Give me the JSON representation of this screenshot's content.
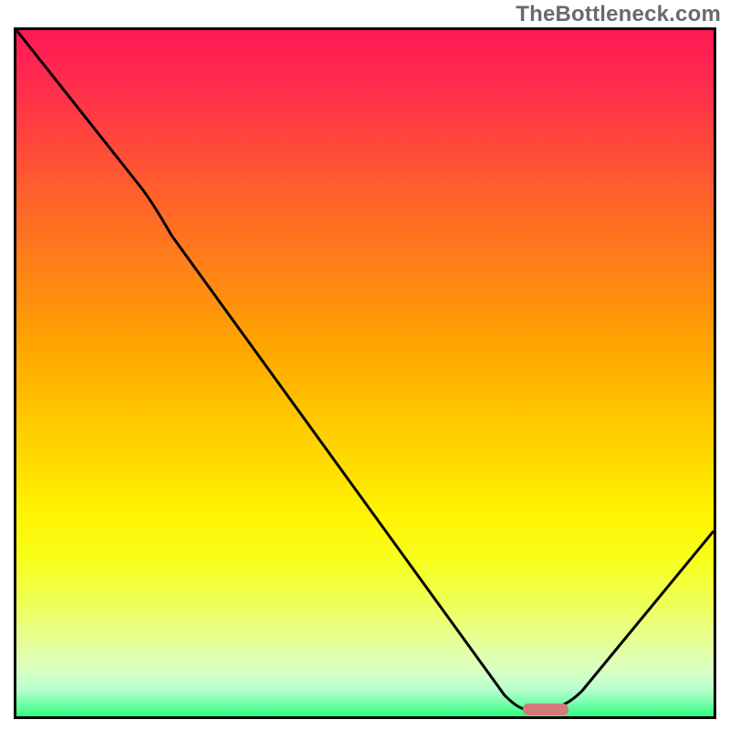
{
  "watermark": "TheBottleneck.com",
  "chart_data": {
    "type": "line",
    "title": "",
    "xlabel": "",
    "ylabel": "",
    "xlim": [
      0,
      100
    ],
    "ylim": [
      0,
      100
    ],
    "series": [
      {
        "name": "bottleneck-curve",
        "x": [
          0,
          18,
          70,
          73,
          76,
          80,
          100
        ],
        "values": [
          100,
          77,
          3,
          1,
          1,
          3,
          27
        ]
      }
    ],
    "marker": {
      "name": "optimal-red-bar",
      "x_start": 73,
      "x_end": 79,
      "y": 1,
      "color": "#d47a7a"
    },
    "gradient_stops": [
      {
        "pos": 0.0,
        "color": "#ff1a55"
      },
      {
        "pos": 0.5,
        "color": "#ffa500"
      },
      {
        "pos": 0.8,
        "color": "#fff200"
      },
      {
        "pos": 1.0,
        "color": "#2fff7f"
      }
    ]
  }
}
